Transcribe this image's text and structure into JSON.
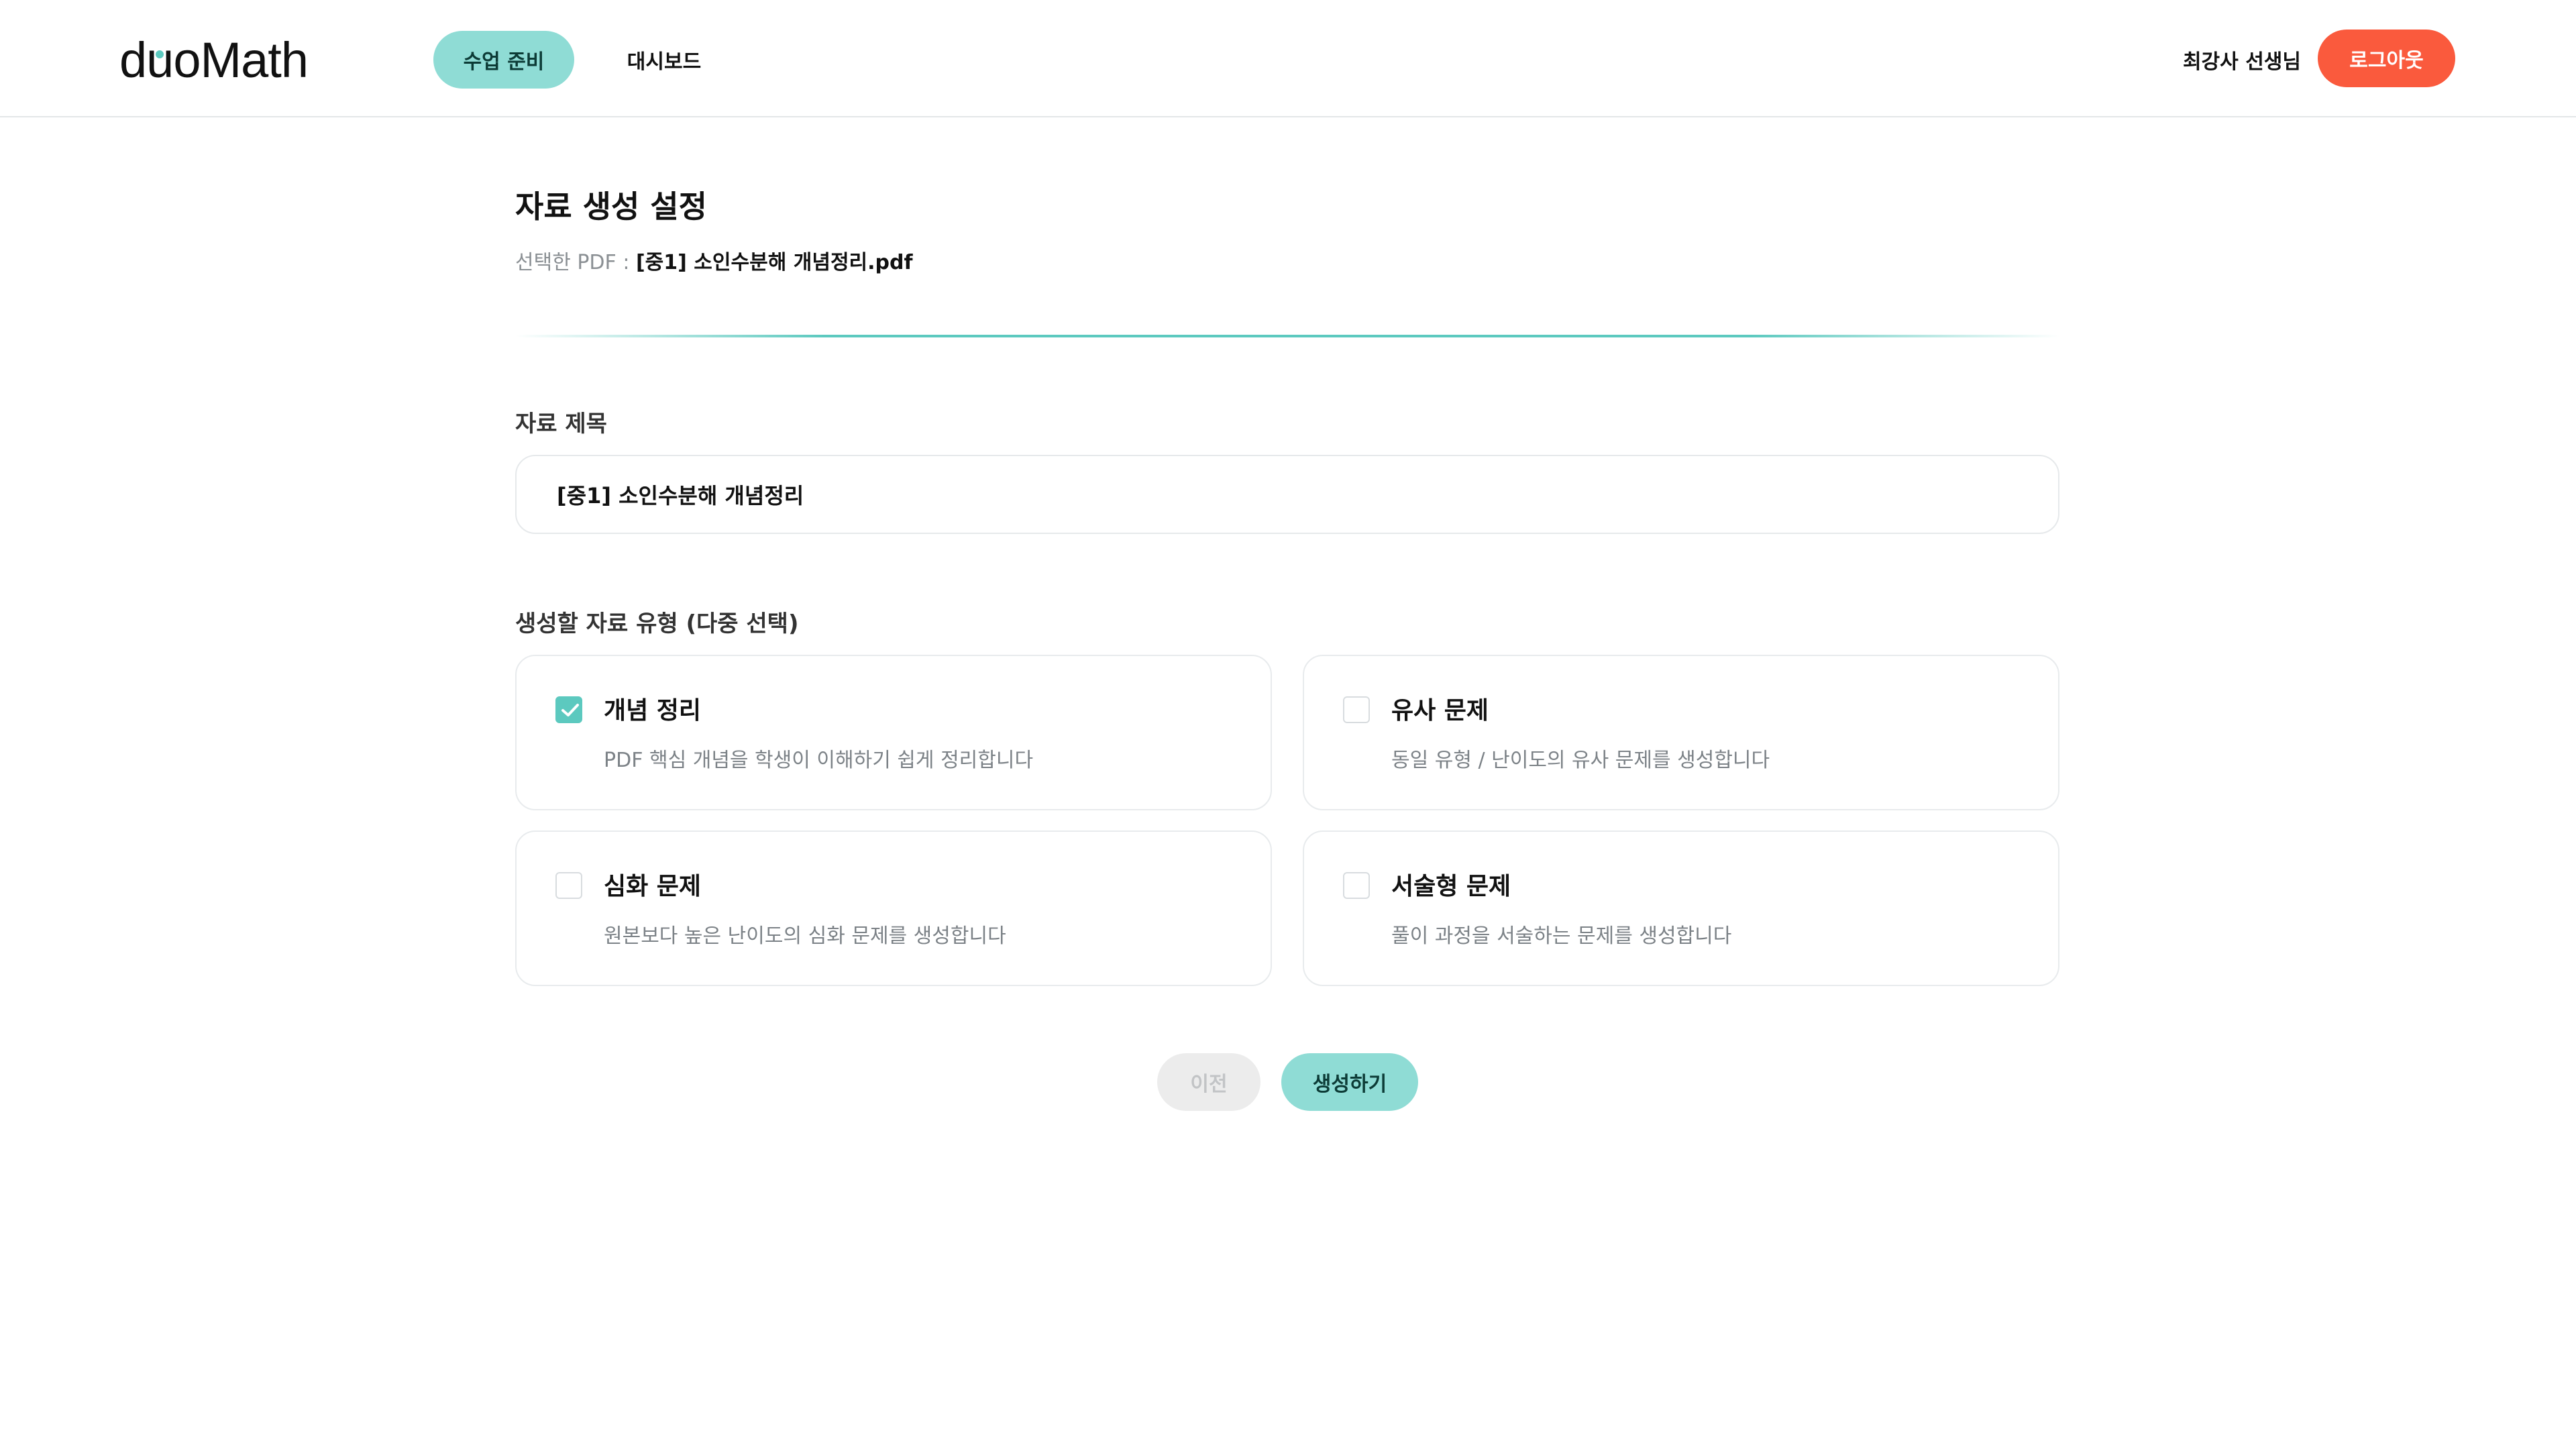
{
  "header": {
    "logo_prefix": "d",
    "logo_u": "u",
    "logo_suffix": "oMath",
    "nav": {
      "prep_label": "수업 준비",
      "dashboard_label": "대시보드"
    },
    "user_name": "최강사 선생님",
    "logout_label": "로그아웃"
  },
  "main": {
    "title": "자료 생성 설정",
    "pdf_prefix": "선택한 PDF : ",
    "pdf_name": "[중1] 소인수분해 개념정리.pdf",
    "title_label": "자료 제목",
    "title_value": "[중1] 소인수분해 개념정리",
    "types_label": "생성할 자료 유형 (다중 선택)",
    "types": [
      {
        "title": "개념 정리",
        "desc": "PDF 핵심 개념을 학생이 이해하기 쉽게 정리합니다",
        "checked": true
      },
      {
        "title": "유사 문제",
        "desc": "동일 유형 / 난이도의 유사 문제를 생성합니다",
        "checked": false
      },
      {
        "title": "심화 문제",
        "desc": "원본보다 높은 난이도의 심화 문제를 생성합니다",
        "checked": false
      },
      {
        "title": "서술형 문제",
        "desc": "풀이 과정을 서술하는 문제를 생성합니다",
        "checked": false
      }
    ],
    "prev_label": "이전",
    "generate_label": "생성하기"
  },
  "colors": {
    "accent": "#8fdcd5",
    "accent_dark": "#5cc9bf",
    "logout": "#fa5a3d"
  },
  "icons": {
    "checkbox_checked": "check-icon"
  }
}
